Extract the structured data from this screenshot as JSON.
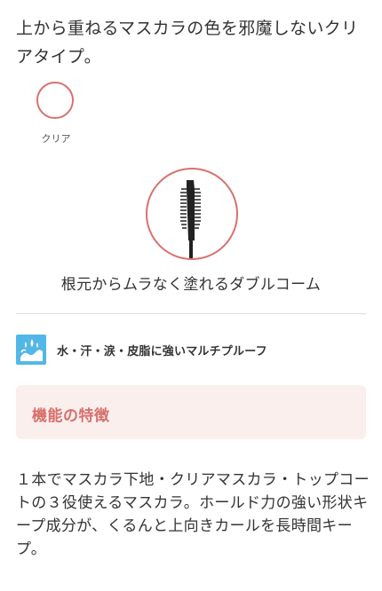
{
  "intro": {
    "text": "上から重ねるマスカラの色を邪魔しないクリアタイプ。"
  },
  "color_options": [
    {
      "label": "クリア",
      "color": "#ffffff",
      "ring_color": "#d9706f"
    }
  ],
  "brush": {
    "caption": "根元からムラなく塗れるダブルコーム",
    "icon": "mascara-brush-icon"
  },
  "feature": {
    "icon": "water-splash-icon",
    "icon_color": "#52b7e6",
    "text": "水・汗・涙・皮脂に強いマルチプルーフ"
  },
  "section": {
    "title": "機能の特徴",
    "background": "#fbefee",
    "title_color": "#d76f6c"
  },
  "description": {
    "text": "１本でマスカラ下地・クリアマスカラ・トップコートの３役使えるマスカラ。ホールド力の強い形状キープ成分が、くるんと上向きカールを長時間キープ。"
  }
}
